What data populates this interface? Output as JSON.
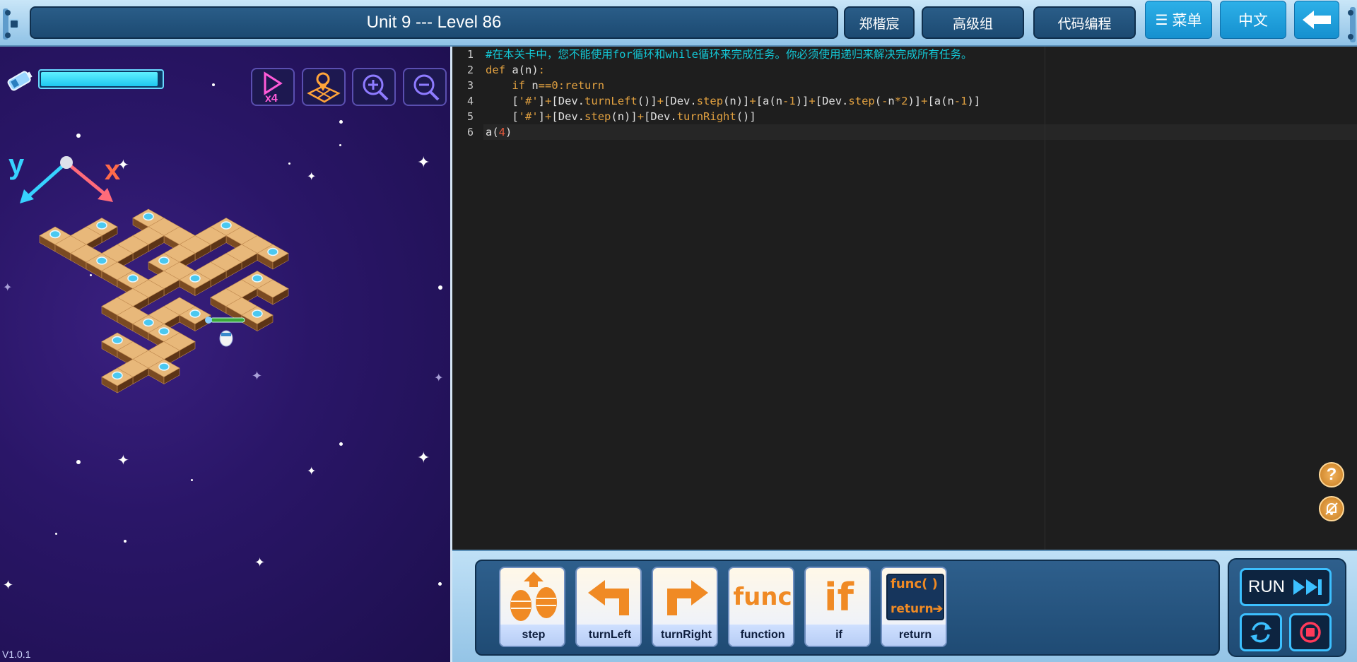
{
  "header": {
    "level_title": "Unit 9 --- Level 86",
    "user_name": "郑楷宸",
    "group": "高级组",
    "mode": "代码编程",
    "menu_label": "菜单",
    "language": "中文"
  },
  "game": {
    "health_fraction": 0.97,
    "axis_y_label": "y",
    "axis_x_label": "x",
    "speed_label": "x4",
    "version": "V1.0.1",
    "tools": [
      "speed-icon",
      "map-icon",
      "zoom-in-icon",
      "zoom-out-icon"
    ]
  },
  "editor": {
    "line_numbers": [
      "1",
      "2",
      "3",
      "4",
      "5",
      "6"
    ],
    "lines": [
      "#在本关卡中，您不能使用for循环和while循环来完成任务。你必须使用递归来解决完成所有任务。",
      "def a(n):",
      "    if n==0:return",
      "    ['#']+[Dev.turnLeft()]+[Dev.step(n)]+[a(n-1)]+[Dev.step(-n*2)]+[a(n-1)]",
      "    ['#']+[Dev.step(n)]+[Dev.turnRight()]",
      "a(4)"
    ]
  },
  "blocks": [
    {
      "label": "step",
      "icon": "step-icon"
    },
    {
      "label": "turnLeft",
      "icon": "turn-left-icon"
    },
    {
      "label": "turnRight",
      "icon": "turn-right-icon"
    },
    {
      "label": "function",
      "icon": "func-icon",
      "icon_text": "func"
    },
    {
      "label": "if",
      "icon": "if-icon",
      "icon_text": "if"
    },
    {
      "label": "return",
      "icon": "return-icon",
      "icon_text_top": "func( )",
      "icon_text_bottom": "return"
    }
  ],
  "controls": {
    "run_label": "RUN",
    "help_label": "?"
  },
  "colors": {
    "accent_blue": "#1590cf",
    "block_orange": "#f08a24",
    "comment_cyan": "#13c8d6",
    "keyword_orange": "#e0a040"
  }
}
